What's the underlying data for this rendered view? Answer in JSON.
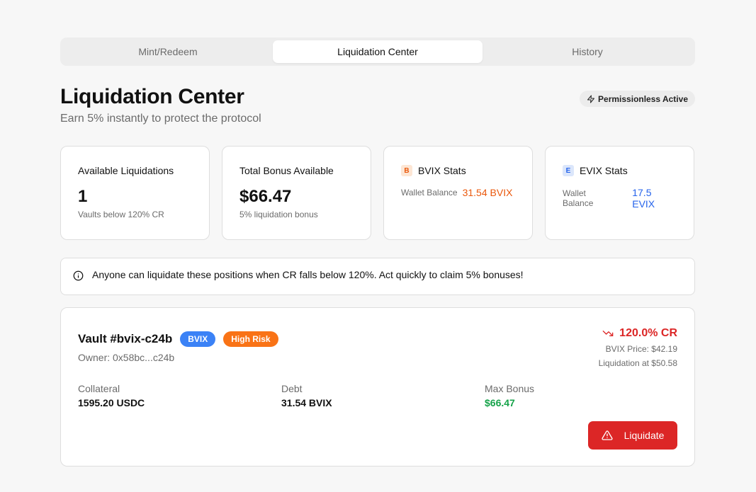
{
  "tabs": [
    {
      "label": "Mint/Redeem"
    },
    {
      "label": "Liquidation Center"
    },
    {
      "label": "History"
    }
  ],
  "header": {
    "title": "Liquidation Center",
    "subtitle": "Earn 5% instantly to protect the protocol",
    "status_badge": "Permissionless Active",
    "status_icon": "lightning-icon"
  },
  "stats": {
    "available": {
      "title": "Available Liquidations",
      "value": "1",
      "sub": "Vaults below 120% CR"
    },
    "bonus": {
      "title": "Total Bonus Available",
      "value": "$66.47",
      "sub": "5% liquidation bonus"
    },
    "bvix": {
      "chip": "B",
      "title": "BVIX Stats",
      "label": "Wallet Balance",
      "value": "31.54 BVIX"
    },
    "evix": {
      "chip": "E",
      "title": "EVIX Stats",
      "label": "Wallet Balance",
      "value": "17.5 EVIX"
    }
  },
  "alert": {
    "icon": "info-icon",
    "text": "Anyone can liquidate these positions when CR falls below 120%. Act quickly to claim 5% bonuses!"
  },
  "vault": {
    "title": "Vault #bvix-c24b",
    "token_badge": "BVIX",
    "risk_badge": "High Risk",
    "owner": "Owner: 0x58bc...c24b",
    "cr": "120.0% CR",
    "price": "BVIX Price: $42.19",
    "liquidation_at": "Liquidation at $50.58",
    "collateral_label": "Collateral",
    "collateral_value": "1595.20 USDC",
    "debt_label": "Debt",
    "debt_value": "31.54 BVIX",
    "bonus_label": "Max Bonus",
    "bonus_value": "$66.47",
    "button_label": "Liquidate"
  },
  "colors": {
    "danger": "#dc2626",
    "success": "#16a34a",
    "bvix_accent": "#ea580c",
    "evix_accent": "#2563eb"
  }
}
